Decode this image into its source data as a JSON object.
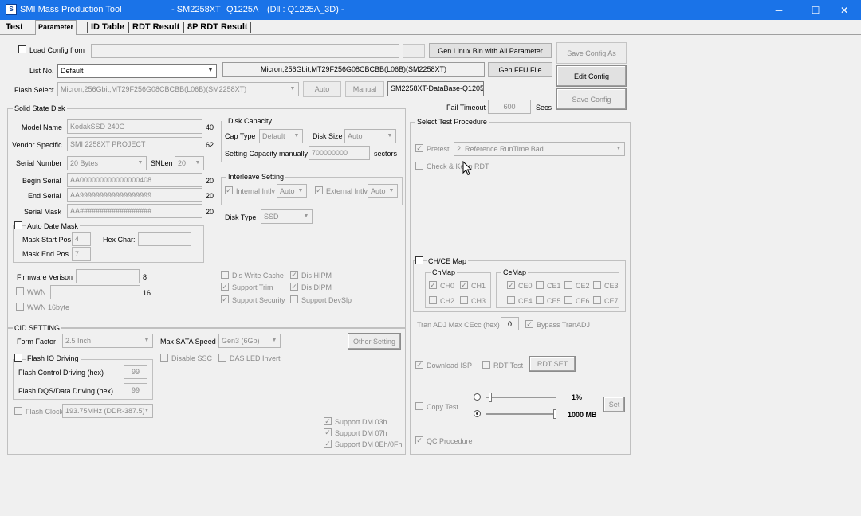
{
  "window": {
    "app": "SMI Mass Production Tool",
    "controller": "- SM2258XT",
    "version": "Q1225A",
    "dll": "(Dll : Q1225A_3D) -",
    "min": "─",
    "max": "☐",
    "close": "✕"
  },
  "tabs": [
    "Test",
    "Parameter",
    "ID Table",
    "RDT Result",
    "8P RDT Result"
  ],
  "top": {
    "load_config_label": "Load Config from",
    "browse": "...",
    "gen_linux_bin": "Gen Linux Bin with All Parameter",
    "save_config_as": "Save Config As",
    "list_no_label": "List No.",
    "list_no_value": "Default",
    "flash_desc": "Micron,256Gbit,MT29F256G08CBCBB(L06B)(SM2258XT)",
    "gen_ffu": "Gen FFU File",
    "edit_config": "Edit Config",
    "flash_select_label": "Flash Select",
    "flash_select_value": "Micron,256Gbit,MT29F256G08CBCBB(L06B)(SM2258XT)",
    "auto": "Auto",
    "manual": "Manual",
    "database": "SM2258XT-DataBase-Q1205",
    "fail_timeout_label": "Fail Timeout",
    "fail_timeout_value": "600",
    "secs": "Secs",
    "save_config": "Save Config"
  },
  "ssd": {
    "title": "Solid State Disk",
    "model_name_label": "Model Name",
    "model_name": "KodakSSD 240G",
    "model_len": "40",
    "vendor_label": "Vendor Specific",
    "vendor": "SMI 2258XT PROJECT",
    "vendor_len": "62",
    "serial_number_label": "Serial Number",
    "serial_number": "20 Bytes",
    "snlen_label": "SNLen",
    "snlen": "20",
    "begin_serial_label": "Begin Serial",
    "begin_serial": "AA000000000000000408",
    "begin_len": "20",
    "end_serial_label": "End Serial",
    "end_serial": "AA999999999999999999",
    "end_len": "20",
    "serial_mask_label": "Serial Mask",
    "serial_mask": "AA##################",
    "mask_len": "20",
    "auto_date_mask": "Auto Date Mask",
    "mask_start_label": "Mask Start Pos",
    "mask_start": "4",
    "hex_char_label": "Hex Char:",
    "mask_end_label": "Mask End Pos",
    "mask_end": "7",
    "fw_label": "Firmware Verison",
    "fw_len": "8",
    "wwn": "WWN",
    "wwn_len": "16",
    "wwn16": "WWN 16byte"
  },
  "disk_capacity": {
    "title": "Disk Capacity",
    "cap_type_label": "Cap Type",
    "cap_type": "Default",
    "disk_size_label": "Disk Size",
    "disk_size": "Auto",
    "setting_label": "Setting Capacity manually",
    "setting_value": "700000000",
    "sectors": "sectors"
  },
  "interleave": {
    "title": "Interleave Setting",
    "internal": "Internal Intlv",
    "internal_val": "Auto",
    "external": "External Intlv",
    "external_val": "Auto"
  },
  "disk_type": {
    "label": "Disk Type",
    "value": "SSD"
  },
  "features": [
    "Dis Write Cache",
    "Dis HIPM",
    "Support Trim",
    "Dis DIPM",
    "Support Security",
    "Support DevSlp"
  ],
  "cid": {
    "title": "CID SETTING",
    "form_factor_label": "Form Factor",
    "form_factor": "2.5 Inch",
    "max_sata_label": "Max SATA Speed",
    "max_sata": "Gen3 (6Gb)",
    "other_setting": "Other Setting",
    "flash_io": "Flash IO Driving",
    "disable_ssc": "Disable SSC",
    "das_led": "DAS LED Invert",
    "ctrl_driving_label": "Flash Control Driving (hex)",
    "ctrl_driving": "99",
    "dqs_driving_label": "Flash DQS/Data Driving (hex)",
    "dqs_driving": "99",
    "flash_clock": "Flash Clock",
    "flash_clock_val": "193.75MHz (DDR-387.5)",
    "dm03": "Support DM 03h",
    "dm07": "Support DM 07h",
    "dm0e": "Support DM 0Eh/0Fh"
  },
  "test_proc": {
    "title": "Select Test Procedure",
    "pretest": "Pretest",
    "pretest_val": "2. Reference RunTime Bad",
    "check_keep": "Check & Keep RDT",
    "chce_map": "CH/CE Map",
    "chmap": "ChMap",
    "cemap": "CeMap",
    "ch": [
      "CH0",
      "CH1",
      "CH2",
      "CH3"
    ],
    "ce": [
      "CE0",
      "CE1",
      "CE2",
      "CE3",
      "CE4",
      "CE5",
      "CE6",
      "CE7"
    ],
    "tran_adj_label": "Tran ADJ Max CEcc (hex)",
    "tran_adj": "0",
    "bypass": "Bypass TranADJ",
    "download_isp": "Download ISP",
    "rdt_test": "RDT Test",
    "rdt_set": "RDT SET",
    "copy_test": "Copy Test",
    "pct": "1%",
    "mb": "1000 MB",
    "set": "Set",
    "qc": "QC Procedure"
  }
}
